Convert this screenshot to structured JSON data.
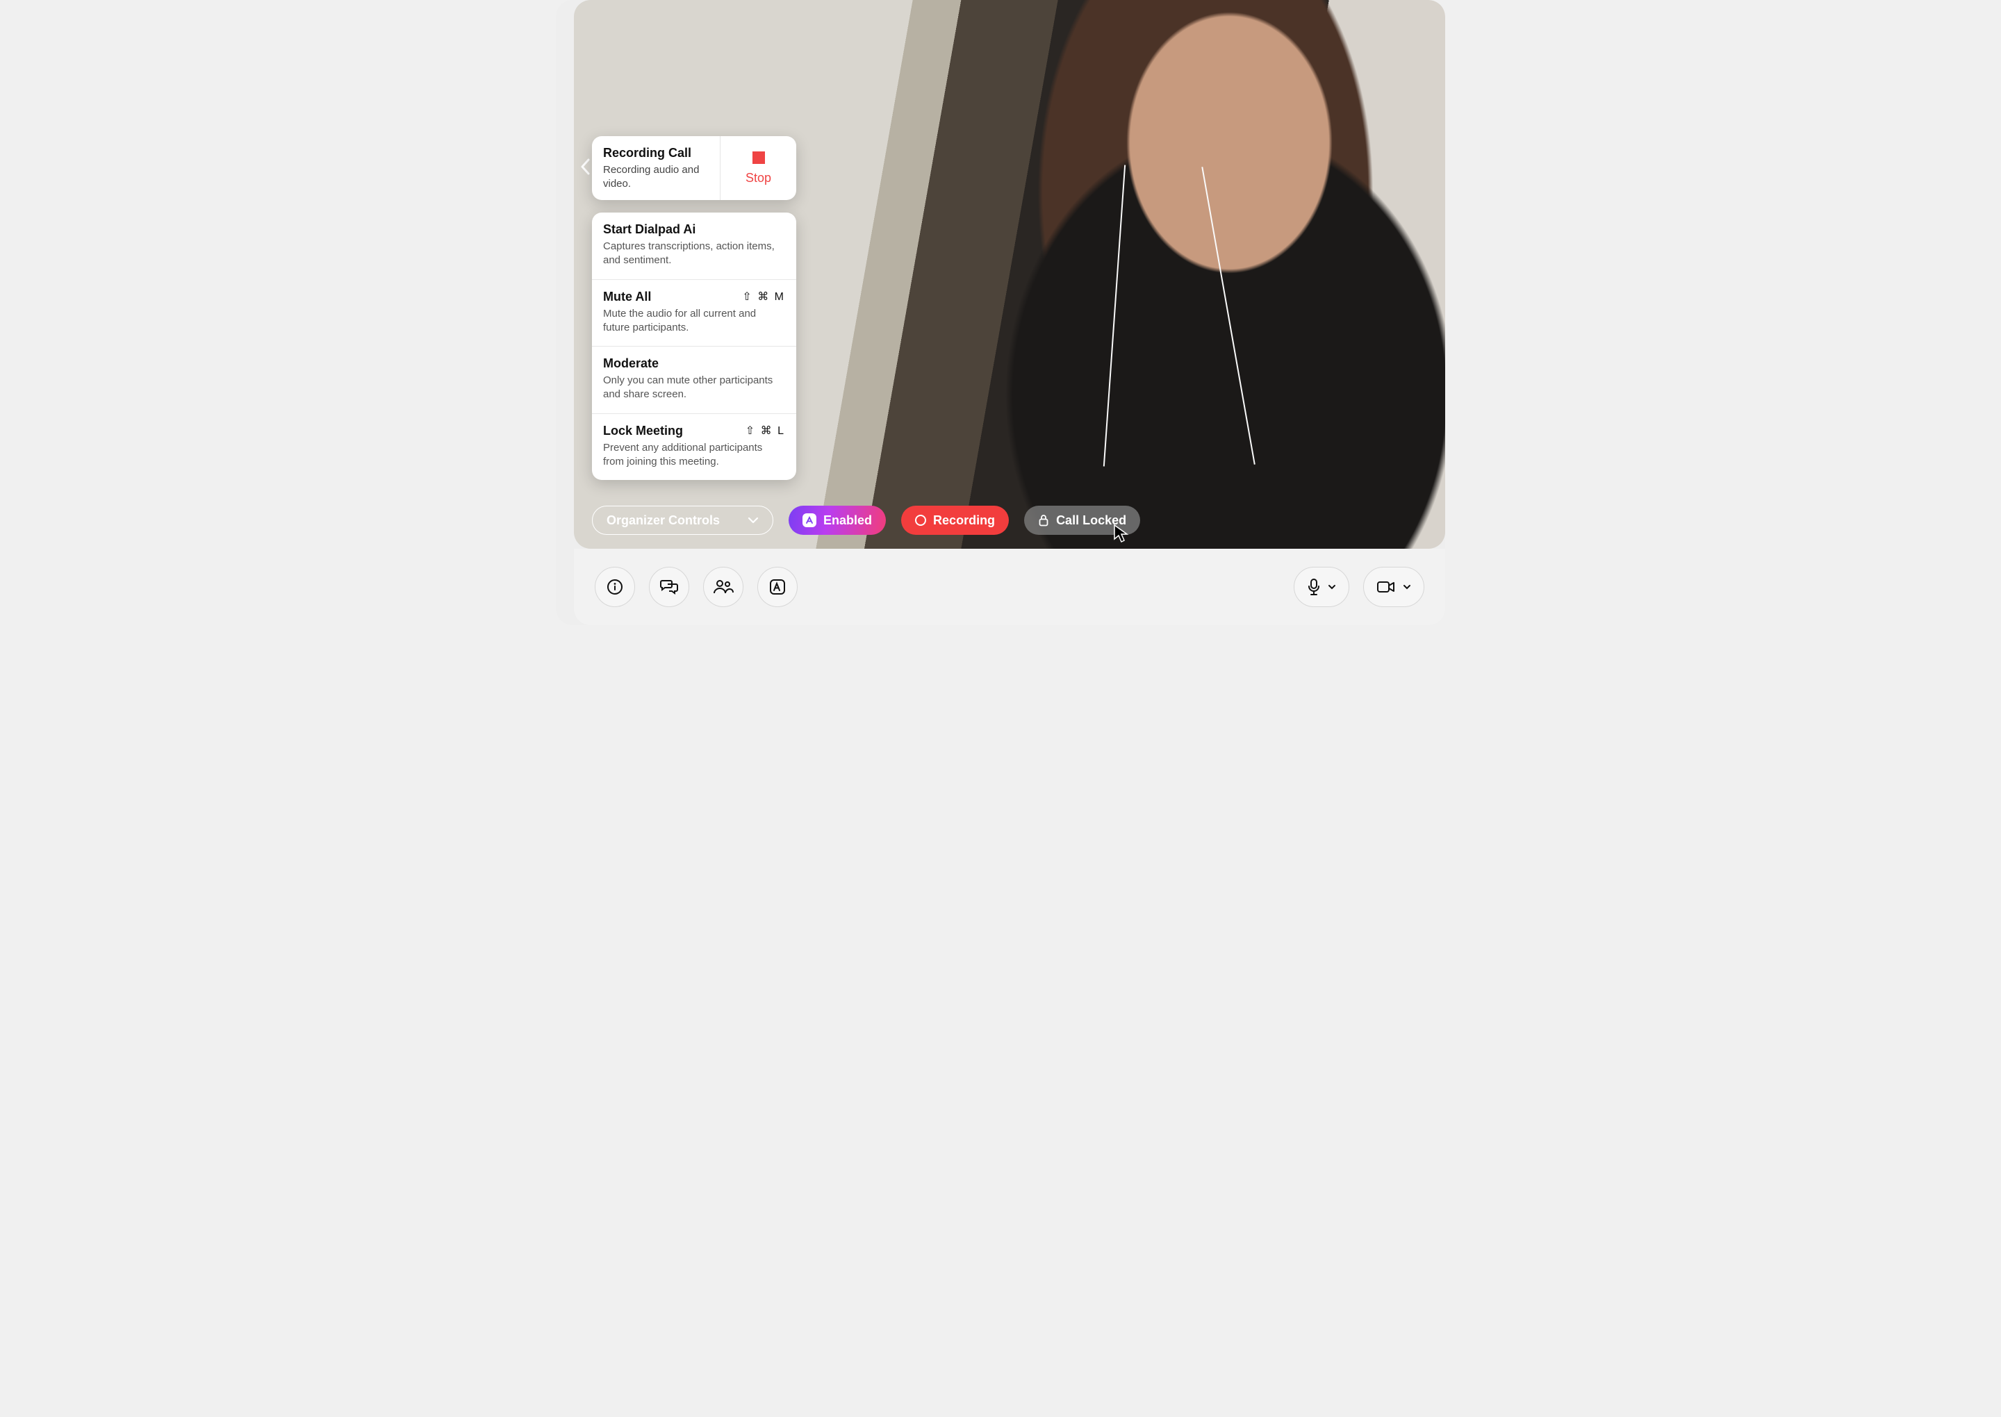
{
  "recording_card": {
    "title": "Recording Call",
    "description": "Recording audio and video.",
    "stop_label": "Stop"
  },
  "menu": [
    {
      "title": "Start Dialpad Ai",
      "description": "Captures transcriptions, action items, and sentiment.",
      "shortcut": ""
    },
    {
      "title": "Mute All",
      "description": "Mute the audio for all current and future participants.",
      "shortcut": "⇧ ⌘ M"
    },
    {
      "title": "Moderate",
      "description": "Only you can mute other participants and share screen.",
      "shortcut": ""
    },
    {
      "title": "Lock Meeting",
      "description": "Prevent any additional participants from joining this meeting.",
      "shortcut": "⇧ ⌘ L"
    }
  ],
  "pills": {
    "organizer_label": "Organizer Controls",
    "enabled_label": "Enabled",
    "recording_label": "Recording",
    "locked_label": "Call Locked"
  }
}
